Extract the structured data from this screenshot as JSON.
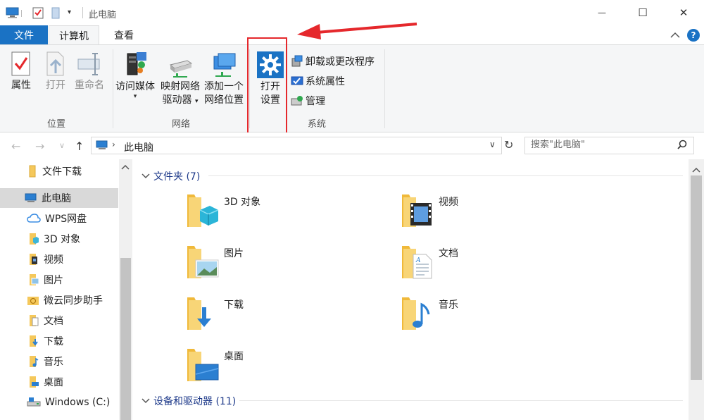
{
  "window": {
    "title": "此电脑",
    "minimize_glyph": "—",
    "maximize_glyph": "☐",
    "close_glyph": "✕"
  },
  "ribbon_tabs": [
    {
      "label": "文件"
    },
    {
      "label": "计算机"
    },
    {
      "label": "查看"
    }
  ],
  "ribbon": {
    "help_glyph": "?",
    "groups": {
      "location": "位置",
      "network": "网络",
      "system": "系统"
    },
    "location_buttons": [
      {
        "label": "属性"
      },
      {
        "label": "打开"
      },
      {
        "label": "重命名"
      }
    ],
    "network_buttons": [
      {
        "label": "访问媒体"
      },
      {
        "label": "映射网络",
        "label2": "驱动器"
      },
      {
        "label": "添加一个",
        "label2": "网络位置"
      }
    ],
    "open_settings": {
      "label": "打开",
      "label2": "设置"
    },
    "system_buttons": [
      {
        "label": "卸载或更改程序"
      },
      {
        "label": "系统属性"
      },
      {
        "label": "管理"
      }
    ]
  },
  "address": {
    "path": "此电脑",
    "search_placeholder": "搜索\"此电脑\""
  },
  "sidebar": {
    "items": [
      {
        "label": "文件下载"
      },
      {
        "label": "此电脑"
      },
      {
        "label": "WPS网盘"
      },
      {
        "label": "3D 对象"
      },
      {
        "label": "视频"
      },
      {
        "label": "图片"
      },
      {
        "label": "微云同步助手"
      },
      {
        "label": "文档"
      },
      {
        "label": "下载"
      },
      {
        "label": "音乐"
      },
      {
        "label": "桌面"
      },
      {
        "label": "Windows (C:)"
      }
    ]
  },
  "main": {
    "folders_header": "文件夹 (7)",
    "devices_header": "设备和驱动器 (11)",
    "folders": [
      {
        "label": "3D 对象"
      },
      {
        "label": "视频"
      },
      {
        "label": "图片"
      },
      {
        "label": "文档"
      },
      {
        "label": "下载"
      },
      {
        "label": "音乐"
      },
      {
        "label": "桌面"
      }
    ]
  },
  "colors": {
    "accent": "#1a72c4",
    "highlight": "#e5282c",
    "folder": "#f5c85b"
  }
}
